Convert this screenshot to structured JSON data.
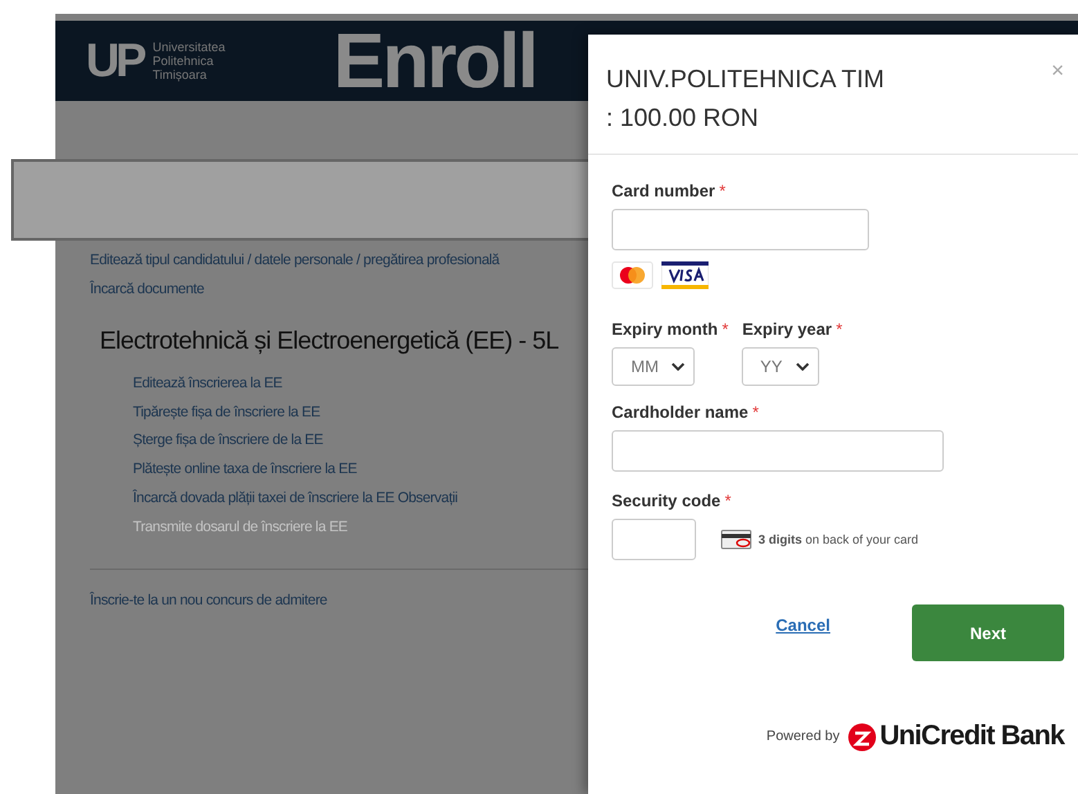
{
  "header": {
    "logo_mark": "UP",
    "university_lines": [
      "Universitatea",
      "Politehnica",
      "Timișoara"
    ],
    "brand": "Enroll"
  },
  "profile_links": [
    {
      "label": "Editează tipul candidatului / datele personale / pregătirea profesională"
    },
    {
      "label": "Încarcă documente"
    }
  ],
  "program": {
    "title": "Electrotehnică și Electroenergetică (EE) - 5L",
    "actions": [
      {
        "label": "Editează înscrierea la EE",
        "disabled": false
      },
      {
        "label": "Tipărește fișa de înscriere la EE",
        "disabled": false
      },
      {
        "label": "Șterge fișa de înscriere de la EE",
        "disabled": false
      },
      {
        "label": "Plătește online taxa de înscriere la EE",
        "disabled": false
      },
      {
        "label": "Încarcă dovada plății taxei de înscriere la EE Observații",
        "disabled": false
      },
      {
        "label": "Transmite dosarul de înscriere la EE",
        "disabled": true
      }
    ]
  },
  "new_contest_link": "Înscrie-te la un nou concurs de admitere",
  "payment_dialog": {
    "merchant": "UNIV.POLITEHNICA TIM",
    "amount": ": 100.00 RON",
    "close": "×",
    "card_number": {
      "label": "Card number",
      "required": "*"
    },
    "expiry_month": {
      "label": "Expiry month",
      "required": "*",
      "value": "MM"
    },
    "expiry_year": {
      "label": "Expiry year",
      "required": "*",
      "value": "YY"
    },
    "cardholder_name": {
      "label": "Cardholder name",
      "required": "*"
    },
    "security_code": {
      "label": "Security code",
      "required": "*",
      "hint": "**3 digits** on back of your card"
    },
    "cancel": "Cancel",
    "next": "Next",
    "powered_by": "Powered by",
    "bank": "UniCredit Bank"
  }
}
